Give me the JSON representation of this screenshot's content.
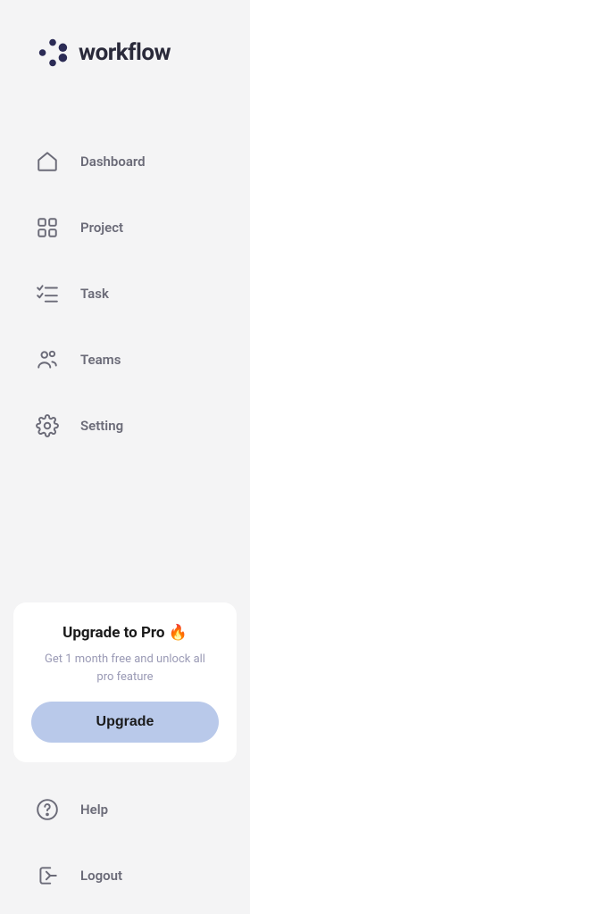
{
  "brand": {
    "name": "workflow"
  },
  "nav": {
    "items": [
      {
        "label": "Dashboard",
        "icon": "home"
      },
      {
        "label": "Project",
        "icon": "grid"
      },
      {
        "label": "Task",
        "icon": "checklist"
      },
      {
        "label": "Teams",
        "icon": "users"
      },
      {
        "label": "Setting",
        "icon": "gear"
      }
    ]
  },
  "upgrade": {
    "title": "Upgrade to Pro 🔥",
    "subtitle": "Get 1 month free and unlock all pro feature",
    "button_label": "Upgrade"
  },
  "footer": {
    "items": [
      {
        "label": "Help",
        "icon": "help"
      },
      {
        "label": "Logout",
        "icon": "logout"
      }
    ]
  }
}
